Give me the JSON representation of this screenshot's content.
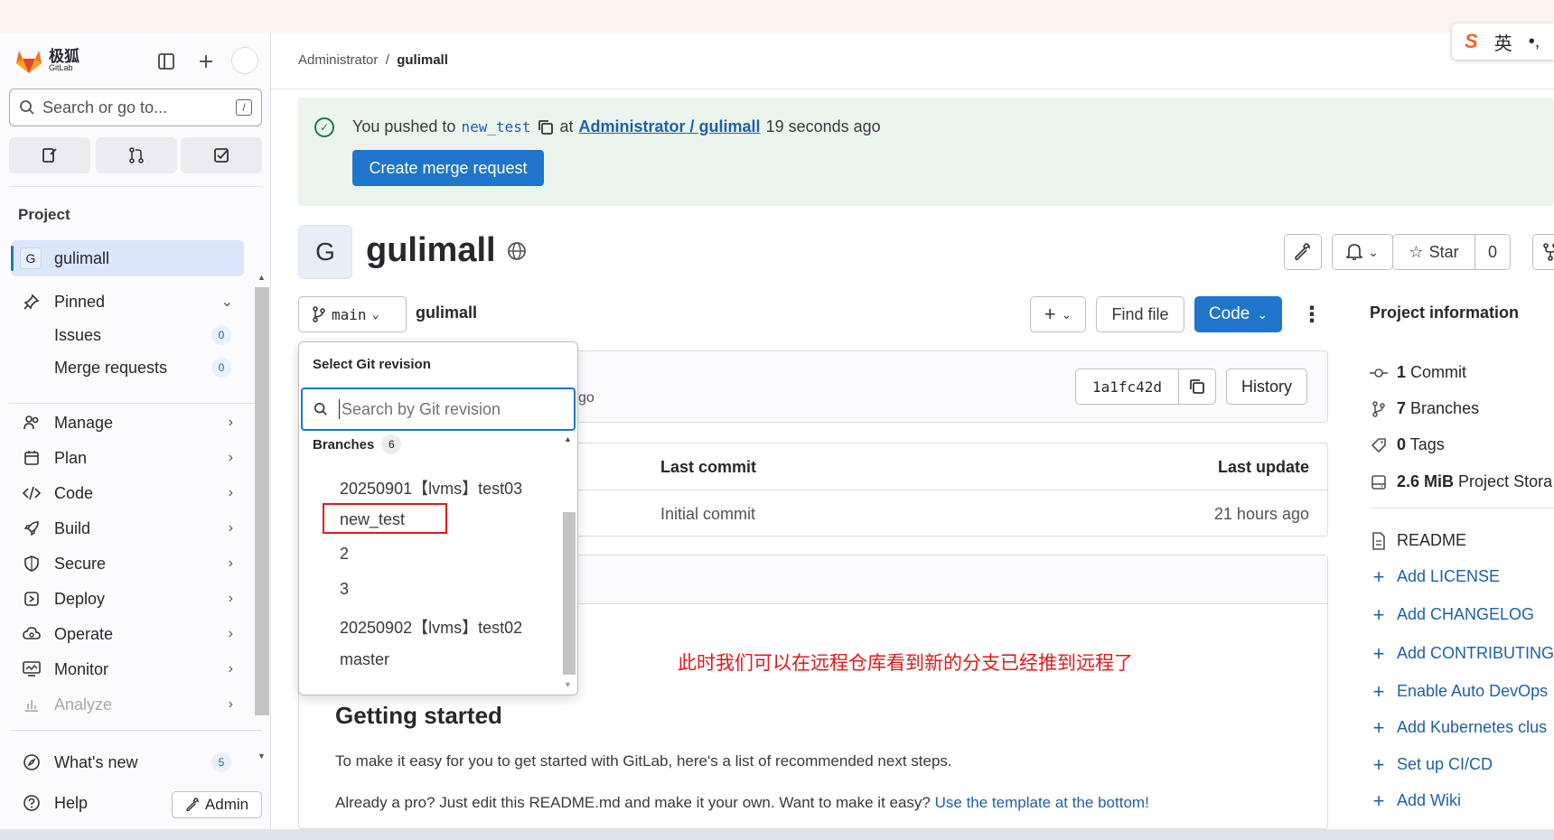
{
  "ime": {
    "label_s": "S",
    "label_lang": "英",
    "label_dot": "•,"
  },
  "sidebar": {
    "brand_cn": "极狐",
    "brand_en": "GitLab",
    "search_placeholder": "Search or go to...",
    "search_shortcut": "/",
    "section_label": "Project",
    "project_initial": "G",
    "project_name": "gulimall",
    "pinned_label": "Pinned",
    "issues_label": "Issues",
    "issues_count": "0",
    "mr_label": "Merge requests",
    "mr_count": "0",
    "nav": [
      "Manage",
      "Plan",
      "Code",
      "Build",
      "Secure",
      "Deploy",
      "Operate",
      "Monitor",
      "Analyze"
    ],
    "whats_new_label": "What's new",
    "whats_new_count": "5",
    "help_label": "Help",
    "admin_label": "Admin"
  },
  "breadcrumb": {
    "owner": "Administrator",
    "sep": "/",
    "project": "gulimall"
  },
  "alert": {
    "prefix": "You pushed to",
    "branch": "new_test",
    "at": "at",
    "repo_link": "Administrator / gulimall",
    "time": "19 seconds ago",
    "button": "Create merge request"
  },
  "project": {
    "initial": "G",
    "title": "gulimall",
    "star_label": "Star",
    "star_count": "0"
  },
  "toolbar": {
    "branch": "main",
    "path_project": "gulimall",
    "find_file": "Find file",
    "code": "Code"
  },
  "commit": {
    "sha": "1a1fc42d",
    "history": "History",
    "time_tail": "go"
  },
  "table": {
    "col_commit": "Last commit",
    "col_update": "Last update",
    "row_commit": "Initial commit",
    "row_update": "21 hours ago"
  },
  "readme": {
    "heading": "Getting started",
    "p1": "To make it easy for you to get started with GitLab, here's a list of recommended next steps.",
    "p2_text": "Already a pro? Just edit this README.md and make it your own. Want to make it easy?",
    "p2_link": "Use the template at the bottom!"
  },
  "annotation": "此时我们可以在远程仓库看到新的分支已经推到远程了",
  "dropdown": {
    "title": "Select Git revision",
    "search_placeholder": "Search by Git revision",
    "section": "Branches",
    "section_count": "6",
    "branches": [
      "20250901【lvms】test03",
      "new_test",
      "2",
      "3",
      "20250902【lvms】test02",
      "master"
    ]
  },
  "project_info": {
    "title": "Project information",
    "commits_num": "1",
    "commits_label": "Commit",
    "branches_num": "7",
    "branches_label": "Branches",
    "tags_num": "0",
    "tags_label": "Tags",
    "storage_num": "2.6 MiB",
    "storage_label": "Project Stora",
    "readme": "README",
    "links": [
      "Add LICENSE",
      "Add CHANGELOG",
      "Add CONTRIBUTING",
      "Enable Auto DevOps",
      "Add Kubernetes clus",
      "Set up CI/CD",
      "Add Wiki"
    ]
  }
}
